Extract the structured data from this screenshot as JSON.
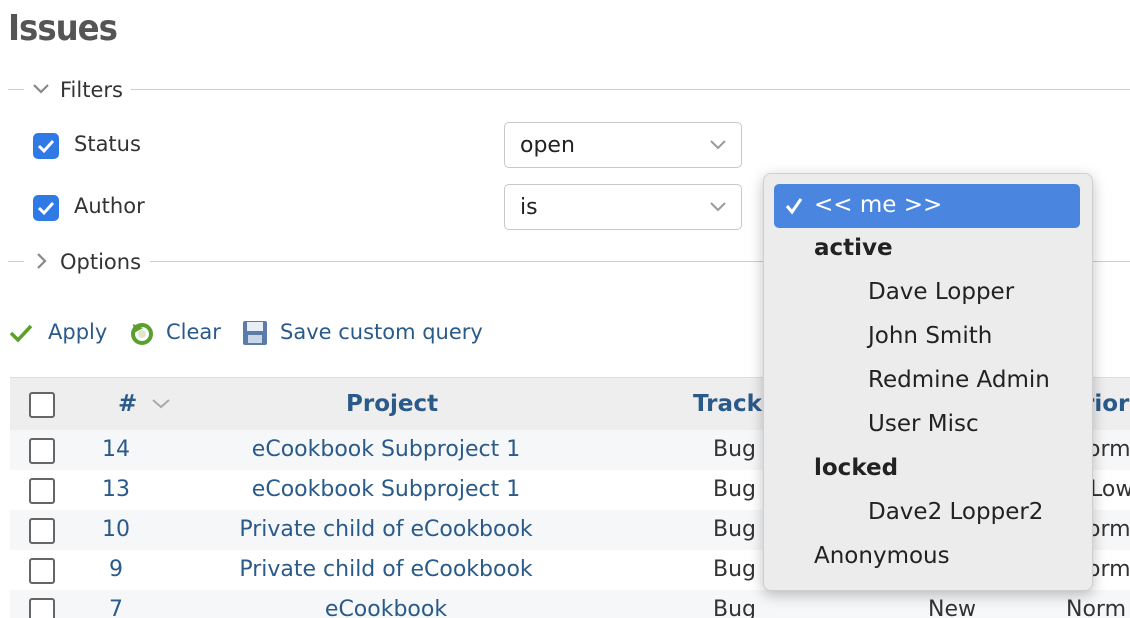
{
  "page": {
    "title": "Issues"
  },
  "filters": {
    "legend": "Filters",
    "rows": [
      {
        "label": "Status",
        "checked": true,
        "operator": "open"
      },
      {
        "label": "Author",
        "checked": true,
        "operator": "is"
      }
    ]
  },
  "options": {
    "legend": "Options"
  },
  "actions": {
    "apply": "Apply",
    "clear": "Clear",
    "save": "Save custom query"
  },
  "table": {
    "headers": {
      "id": "#",
      "project": "Project",
      "tracker": "Track",
      "priority": "rior"
    },
    "rows": [
      {
        "id": "14",
        "project": "eCookbook Subproject 1",
        "tracker": "Bug",
        "status": "",
        "priority": "orm"
      },
      {
        "id": "13",
        "project": "eCookbook Subproject 1",
        "tracker": "Bug",
        "status": "",
        "priority": "Low"
      },
      {
        "id": "10",
        "project": "Private child of eCookbook",
        "tracker": "Bug",
        "status": "",
        "priority": "orm"
      },
      {
        "id": "9",
        "project": "Private child of eCookbook",
        "tracker": "Bug",
        "status": "",
        "priority": "orm"
      },
      {
        "id": "7",
        "project": "eCookbook",
        "tracker": "Bug",
        "status": "New",
        "priority": "Norm"
      }
    ]
  },
  "author_dropdown": {
    "selected": "<< me >>",
    "group_active": "active",
    "active_users": [
      "Dave Lopper",
      "John Smith",
      "Redmine Admin",
      "User Misc"
    ],
    "group_locked": "locked",
    "locked_users": [
      "Dave2 Lopper2"
    ],
    "anonymous": "Anonymous"
  },
  "colors": {
    "accent": "#2f7ae5",
    "link": "#2a5a8a",
    "selected_bg": "#4a86e0"
  },
  "icons": [
    "chevron-down-icon",
    "chevron-right-icon",
    "checkmark-icon",
    "refresh-icon",
    "save-icon",
    "sort-icon"
  ]
}
